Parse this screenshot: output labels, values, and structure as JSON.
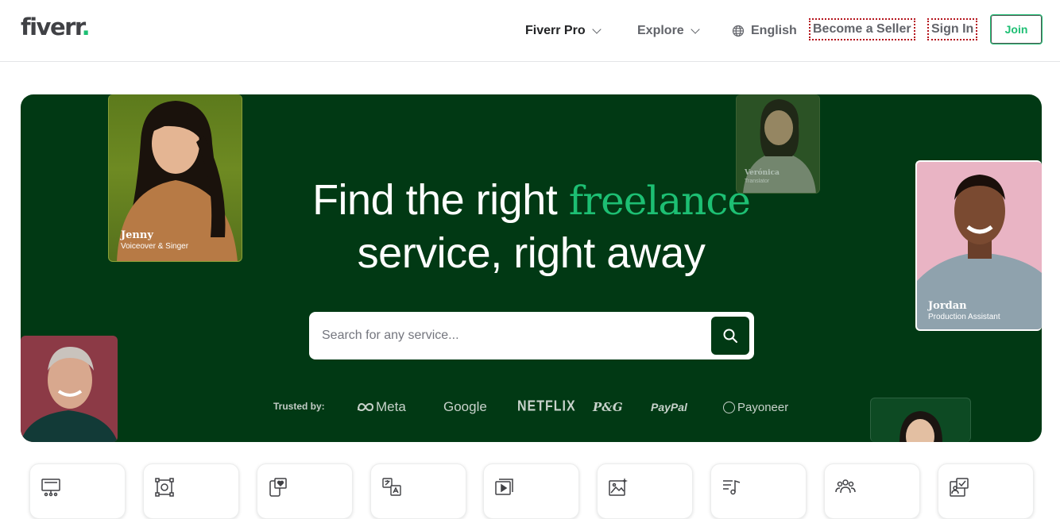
{
  "header": {
    "logo_text": "fiverr",
    "logo_dot": ".",
    "nav": {
      "fiverr_pro": "Fiverr Pro",
      "explore": "Explore",
      "language": "English",
      "become_seller": "Become a Seller",
      "sign_in": "Sign In",
      "join": "Join"
    },
    "icons": [
      "chevron-down-icon",
      "globe-icon"
    ]
  },
  "hero": {
    "headline_part1": "Find the right ",
    "headline_accent": "freelance",
    "headline_part2": "service, right away",
    "search": {
      "placeholder": "Search for any service...",
      "value": "",
      "button_icon": "search-icon"
    },
    "trusted_label": "Trusted by:",
    "brands": [
      "Meta",
      "Google",
      "NETFLIX",
      "P&G",
      "PayPal",
      "Payoneer"
    ],
    "sellers": [
      {
        "name": "Jenny",
        "role": "Voiceover & Singer"
      },
      {
        "name": "Verónica",
        "role": "Translator"
      },
      {
        "name": "Jordan",
        "role": "Production Assistant"
      }
    ]
  },
  "categories": [
    {
      "icon": "monitor-code-icon"
    },
    {
      "icon": "design-frame-icon"
    },
    {
      "icon": "phone-heart-icon"
    },
    {
      "icon": "translate-icon"
    },
    {
      "icon": "video-play-icon"
    },
    {
      "icon": "image-sparkle-icon"
    },
    {
      "icon": "music-list-icon"
    },
    {
      "icon": "people-icon"
    },
    {
      "icon": "checklist-icon"
    }
  ],
  "colors": {
    "brand_green": "#1dbf73",
    "hero_bg": "#013914",
    "text_dark": "#404145"
  }
}
